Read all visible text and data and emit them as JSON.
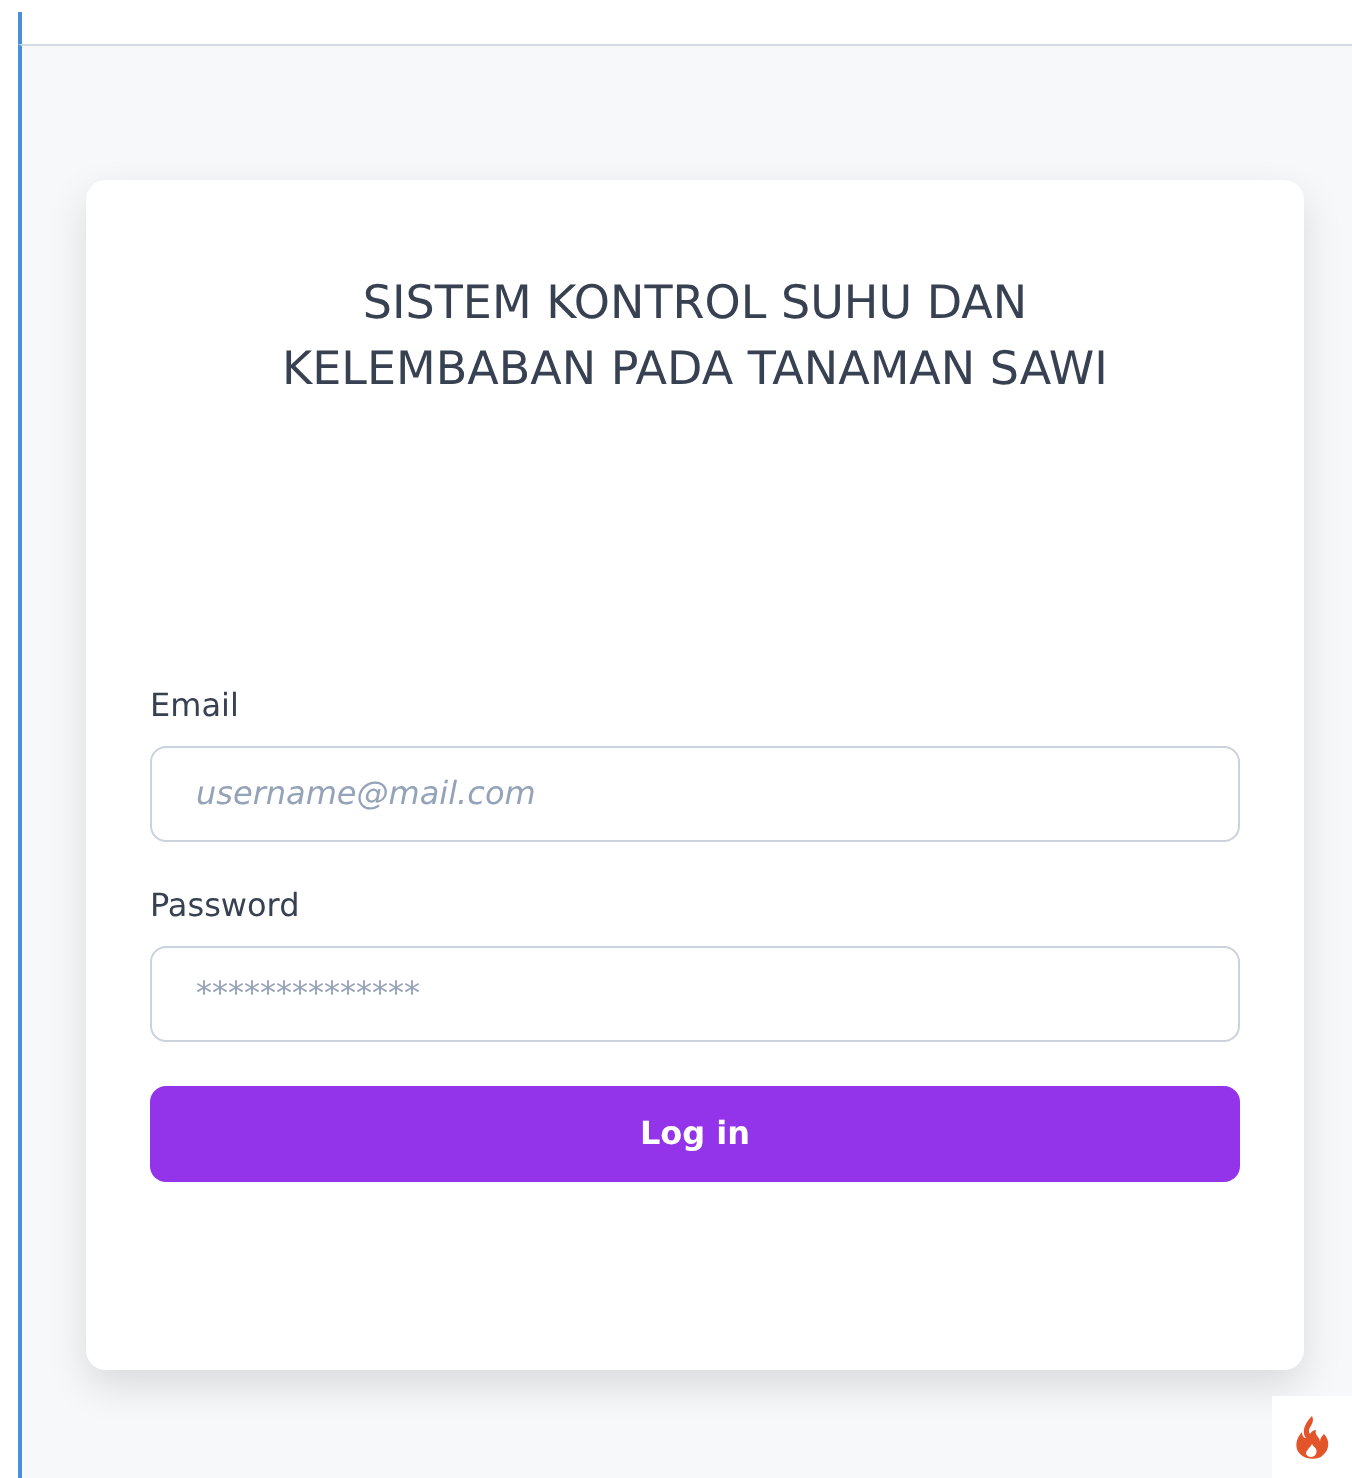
{
  "title": "SISTEM KONTROL SUHU DAN KELEMBABAN PADA TANAMAN SAWI",
  "fields": [
    {
      "label": "Email",
      "placeholder": "username@mail.com",
      "kind": "email"
    },
    {
      "label": "Password",
      "placeholder": "**************",
      "kind": "password"
    }
  ],
  "button": "Log in"
}
